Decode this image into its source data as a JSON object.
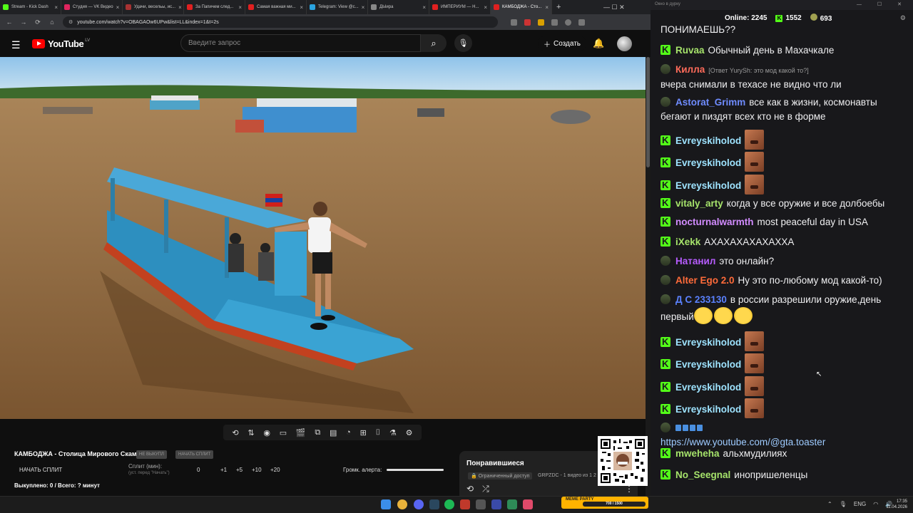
{
  "browser": {
    "tabs": [
      {
        "label": "Stream - Kick Dash",
        "color": "#53fc18",
        "active": false
      },
      {
        "label": "Студия — VK Видео",
        "color": "#e0245e",
        "active": false
      },
      {
        "label": "Удачи, весельы, ис...",
        "color": "#a83232",
        "active": false
      },
      {
        "label": "За Папичем след...",
        "color": "#e02020",
        "active": false
      },
      {
        "label": "Самая важная ми...",
        "color": "#e02020",
        "active": false
      },
      {
        "label": "Telegram: View @c...",
        "color": "#2aa3e0",
        "active": false
      },
      {
        "label": "ДЫира",
        "color": "#888888",
        "active": false
      },
      {
        "label": "ИМПЕРИУМ — Н...",
        "color": "#e02020",
        "active": false
      },
      {
        "label": "КАМБОДЖА - Сто...",
        "color": "#e02020",
        "active": true
      }
    ],
    "url": "youtube.com/watch?v=OBAGAOw6UPw&list=LL&index=1&t=2s",
    "new_tab": "+",
    "win_controls": "—   ☐   ✕"
  },
  "youtube": {
    "logo_text": "YouTube",
    "region": "LV",
    "search_placeholder": "Введите запрос",
    "create_label": "Создать"
  },
  "video_panel": {
    "title": "КАМБОДЖА - Столица Мирового Скама",
    "tag1": "НЕ ВЫКУПЛ",
    "tag2": "НАЧАТЬ СПЛИТ",
    "start_split": "НАЧАТЬ СПЛИТ",
    "split_label": "Сплит (мин):",
    "split_hint": "(уст. перед \"Начать\")",
    "split_values": [
      "0",
      "+1",
      "+5",
      "+10",
      "+20"
    ],
    "alert_volume_label": "Громк. алерта:",
    "alert_volume": 1.0,
    "bought": "Выкуплено: 0 / Всего: ? минут"
  },
  "liked_panel": {
    "title": "Понравившиеся",
    "restricted": "Ограниченный доступ",
    "meta": "GRPZDC - 1 видео из 1 2"
  },
  "taskbar": {
    "lang": "ENG",
    "time": "17:35",
    "date": "11.04.2026",
    "meme_party": "MEME PARTY",
    "meme_bar": "700 / 1500"
  },
  "chat": {
    "window_title": "Окно в дурку",
    "online_label": "Online:",
    "online": "2245",
    "kick_count": "1552",
    "other_count": "693",
    "messages": [
      {
        "badge": "none",
        "user": "",
        "color": "#efeff1",
        "text": "ПОНИМАЕШЬ??",
        "emotes": 0
      },
      {
        "badge": "kick",
        "user": "Ruvaa",
        "color": "#a6e36b",
        "text": "Обычный день в Махачкале",
        "emotes": 0
      },
      {
        "badge": "sol",
        "user": "Килла",
        "color": "#ff6b5a",
        "reply": "[Ответ YurySh: это мод какой то?]",
        "text": "вчера снимали в техасе не видно что ли",
        "emotes": 0
      },
      {
        "badge": "sol",
        "user": "Astorat_Grimm",
        "color": "#6f8cff",
        "text": "все как в жизни, космонавты бегают и пиздят всех кто не в форме",
        "emotes": 0
      },
      {
        "badge": "kick",
        "user": "Evreyskiholod",
        "color": "#9ee3ff",
        "text": "",
        "emotes": 1
      },
      {
        "badge": "kick",
        "user": "Evreyskiholod",
        "color": "#9ee3ff",
        "text": "",
        "emotes": 1
      },
      {
        "badge": "kick",
        "user": "Evreyskiholod",
        "color": "#9ee3ff",
        "text": "",
        "emotes": 1
      },
      {
        "badge": "kick",
        "user": "vitaly_arty",
        "color": "#a6e36b",
        "text": "когда у все оружие и все долбоебы",
        "emotes": 0
      },
      {
        "badge": "kick",
        "user": "nocturnalwarmth",
        "color": "#d28cff",
        "text": "most peaceful day in USA",
        "emotes": 0
      },
      {
        "badge": "kick",
        "user": "iXekk",
        "color": "#a6e36b",
        "text": "АХАХАХАХАХАХХА",
        "emotes": 0
      },
      {
        "badge": "sol",
        "user": "Натанил",
        "color": "#b75cff",
        "text": "это онлайн?",
        "emotes": 0
      },
      {
        "badge": "sol",
        "user": "Alter Ego 2.0",
        "color": "#ff6b3a",
        "text": "Ну это по-любому мод какой-то)",
        "emotes": 0
      },
      {
        "badge": "sol",
        "user": "Д С 233130",
        "color": "#5b82ff",
        "text": "в россии разрешили оружие,день первый",
        "emotes": 3
      },
      {
        "badge": "kick",
        "user": "Evreyskiholod",
        "color": "#9ee3ff",
        "text": "",
        "emotes": 1
      },
      {
        "badge": "kick",
        "user": "Evreyskiholod",
        "color": "#9ee3ff",
        "text": "",
        "emotes": 1
      },
      {
        "badge": "kick",
        "user": "Evreyskiholod",
        "color": "#9ee3ff",
        "text": "",
        "emotes": 1
      },
      {
        "badge": "kick",
        "user": "Evreyskiholod",
        "color": "#9ee3ff",
        "text": "",
        "emotes": 1
      },
      {
        "badge": "sol",
        "user": "",
        "color": "#efeff1",
        "text": "",
        "emotes": 0,
        "link": "https://www.youtube.com/@gta.toaster"
      },
      {
        "badge": "kick",
        "user": "mweheha",
        "color": "#a6e36b",
        "text": "альхмудилиях",
        "emotes": 0
      },
      {
        "badge": "kick",
        "user": "No_Seegnal",
        "color": "#a6e36b",
        "text": "инопришеленцы",
        "emotes": 0
      }
    ]
  }
}
